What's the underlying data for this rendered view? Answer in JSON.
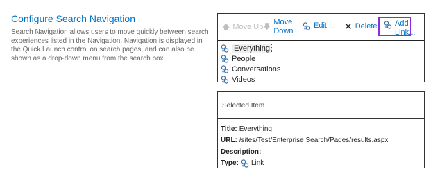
{
  "section": {
    "title": "Configure Search Navigation",
    "description": "Search Navigation allows users to move quickly between search experiences listed in the Navigation. Navigation is displayed in the Quick Launch control on search pages, and can also be shown as a drop-down menu from the search box."
  },
  "toolbar": {
    "move_up": "Move Up",
    "move_down": "Move Down",
    "edit": "Edit...",
    "delete": "Delete",
    "add_link": "Add Link..."
  },
  "nav_items": [
    {
      "label": "Everything",
      "icon": "link-icon",
      "selected": true
    },
    {
      "label": "People",
      "icon": "link-icon"
    },
    {
      "label": "Conversations",
      "icon": "link-icon"
    },
    {
      "label": "Videos",
      "icon": "link-icon"
    }
  ],
  "selected_item": {
    "header": "Selected Item",
    "title_label": "Title:",
    "title_value": "Everything",
    "url_label": "URL:",
    "url_value": "/sites/Test/Enterprise Search/Pages/results.aspx",
    "description_label": "Description:",
    "description_value": "",
    "type_label": "Type:",
    "type_value": "Link"
  },
  "colors": {
    "accent": "#0072c6",
    "highlight_border": "#8a2be2",
    "disabled": "#bfbfbf"
  }
}
